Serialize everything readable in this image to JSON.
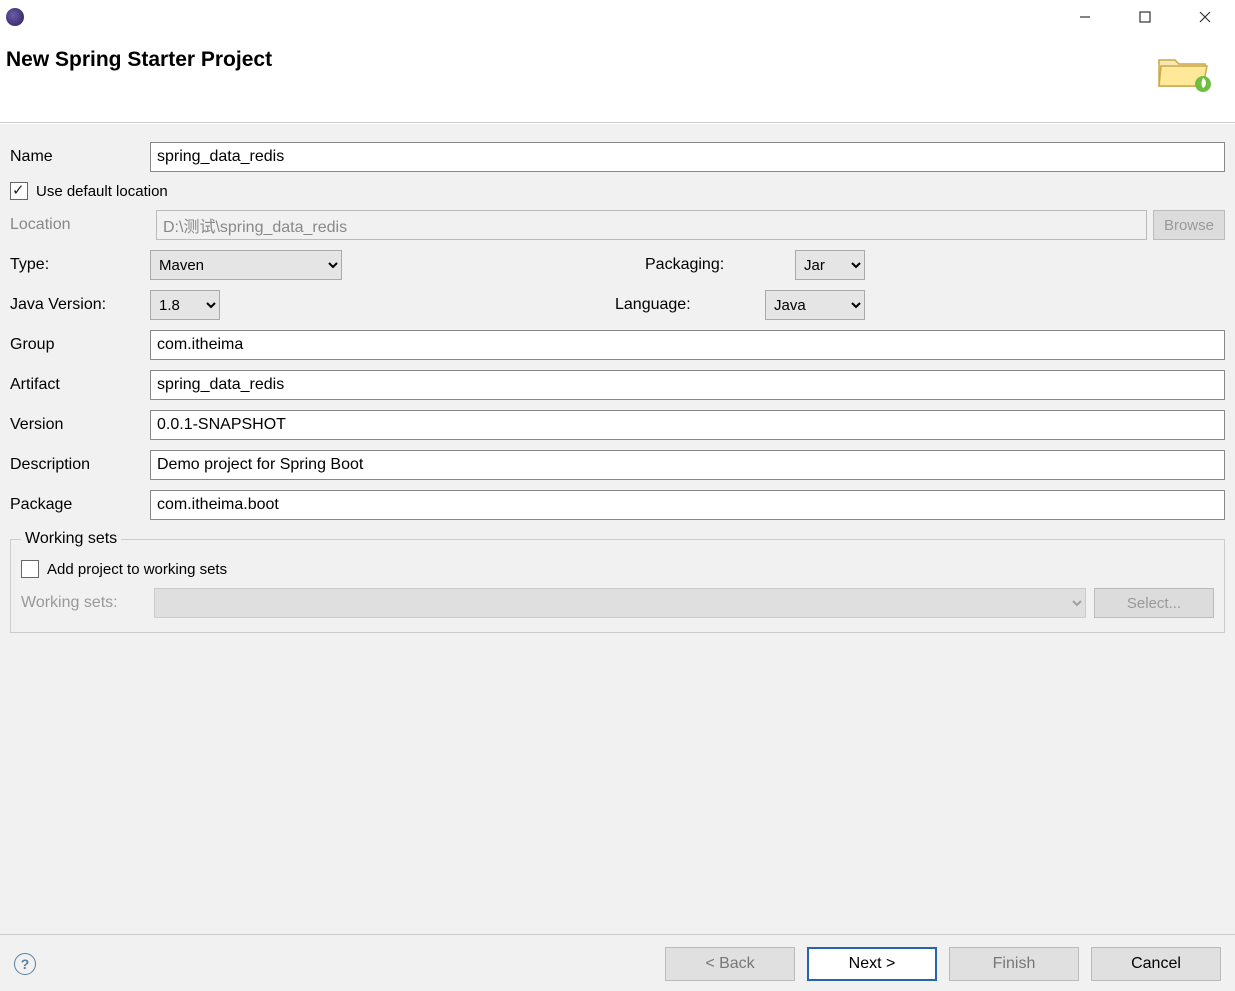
{
  "header": {
    "title": "New Spring Starter Project"
  },
  "labels": {
    "name": "Name",
    "use_default_location": "Use default location",
    "location": "Location",
    "browse": "Browse",
    "type": "Type:",
    "packaging": "Packaging:",
    "java_version": "Java Version:",
    "language": "Language:",
    "group": "Group",
    "artifact": "Artifact",
    "version": "Version",
    "description": "Description",
    "package": "Package",
    "working_sets_legend": "Working sets",
    "add_to_ws": "Add project to working sets",
    "working_sets_label": "Working sets:",
    "select_btn": "Select..."
  },
  "values": {
    "name": "spring_data_redis",
    "location": "D:\\测试\\spring_data_redis",
    "type": "Maven",
    "packaging": "Jar",
    "java_version": "1.8",
    "language": "Java",
    "group": "com.itheima",
    "artifact": "spring_data_redis",
    "version": "0.0.1-SNAPSHOT",
    "description": "Demo project for Spring Boot",
    "package": "com.itheima.boot"
  },
  "buttons": {
    "back": "< Back",
    "next": "Next >",
    "finish": "Finish",
    "cancel": "Cancel"
  }
}
